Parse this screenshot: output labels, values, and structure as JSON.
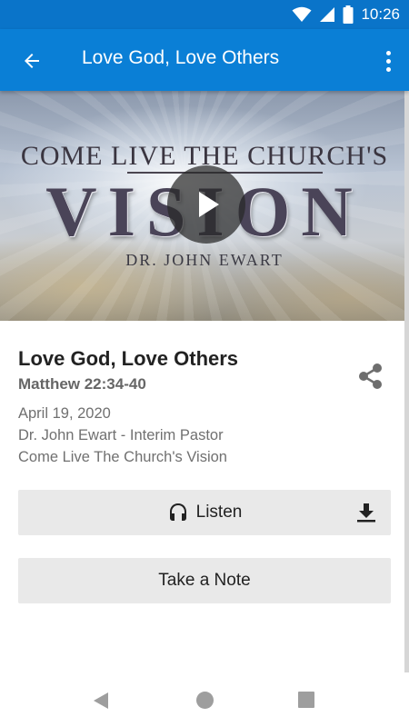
{
  "status_bar": {
    "time": "10:26",
    "icons": [
      "wifi-icon",
      "cell-signal-icon",
      "battery-icon"
    ]
  },
  "app_bar": {
    "title": "Love God, Love Others",
    "back_icon": "arrow-left-icon",
    "menu_icon": "more-vert-icon",
    "color": "#0a7fd6"
  },
  "hero": {
    "line1": "Come Live The Church's",
    "line2": "Vision",
    "line3": "Dr. John Ewart",
    "play_icon": "play-icon"
  },
  "sermon": {
    "title": "Love God, Love Others",
    "scripture": "Matthew 22:34-40",
    "date": "April 19, 2020",
    "speaker": "Dr. John Ewart - Interim Pastor",
    "series": "Come Live The Church's Vision",
    "share_icon": "share-icon"
  },
  "actions": {
    "listen_label": "Listen",
    "listen_icon": "headphones-icon",
    "download_icon": "download-icon",
    "note_label": "Take a Note"
  },
  "nav_bar": {
    "icons": [
      "nav-back-icon",
      "nav-home-icon",
      "nav-recents-icon"
    ]
  }
}
